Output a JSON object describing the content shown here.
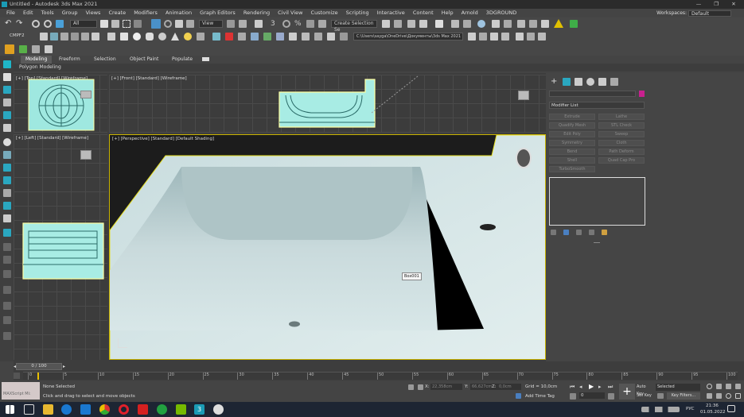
{
  "window": {
    "title": "Untitled - Autodesk 3ds Max 2021",
    "buttons": {
      "minimize": "—",
      "restore": "❐",
      "close": "✕"
    }
  },
  "menu": {
    "items": [
      "File",
      "Edit",
      "Tools",
      "Group",
      "Views",
      "Create",
      "Modifiers",
      "Animation",
      "Graph Editors",
      "Rendering",
      "Civil View",
      "Customize",
      "Scripting",
      "Interactive",
      "Content",
      "Help",
      "Arnold",
      "3DGROUND"
    ],
    "workspaces_label": "Workspaces:",
    "workspaces_value": "Default"
  },
  "toolbar": {
    "selection_filter": "All",
    "ref_coord": "View",
    "named_selection": "Create Selection Se",
    "project_path": "C:\\Users\\sayga\\OneDrive\\Документы\\3ds Max 2021",
    "cmp_label": "CMPF2"
  },
  "ribbon": {
    "tabs": [
      "Modeling",
      "Freeform",
      "Selection",
      "Object Paint",
      "Populate"
    ],
    "active_tab": "Modeling",
    "sub_label": "Polygon Modeling"
  },
  "viewports": {
    "top": "[+] [Top] [Standard] [Wireframe]",
    "front": "[+] [Front] [Standard] [Wireframe]",
    "left": "[+] [Left] [Standard] [Wireframe]",
    "perspective": "[+] [Perspective] [Standard] [Default Shading]",
    "object_tooltip": "Box001"
  },
  "command_panel": {
    "modifier_list": "Modifier List",
    "swatch_color": "#c8208f",
    "buttons": [
      "Extrude",
      "Lathe",
      "Quadify Mesh",
      "STL Check",
      "Edit Poly",
      "Sweep",
      "Symmetry",
      "Cloth",
      "Bend",
      "Path Deform",
      "Shell",
      "Quad Cap Pro",
      "TurboSmooth"
    ]
  },
  "timeline": {
    "frame_counter": "0 / 100",
    "ticks": [
      "0",
      "5",
      "10",
      "15",
      "20",
      "25",
      "30",
      "35",
      "40",
      "45",
      "50",
      "55",
      "60",
      "65",
      "70",
      "75",
      "80",
      "85",
      "90",
      "95",
      "100"
    ],
    "slider_fraction": 0.0
  },
  "status": {
    "maxscript": "MAXScript Mi:",
    "selection": "None Selected",
    "prompt": "Click and drag to select and move objects",
    "x_label": "X:",
    "x_value": "22,358cm",
    "y_label": "Y:",
    "y_value": "66,627cm",
    "z_label": "Z:",
    "z_value": "0,0cm",
    "grid": "Grid = 10,0cm",
    "add_time_tag": "Add Time Tag",
    "frame": "0",
    "auto_key": "Auto Key",
    "set_key": "Set Key",
    "selected": "Selected",
    "key_filters": "Key Filters..."
  },
  "taskbar": {
    "lang": "РУС",
    "time": "21:36",
    "date": "01.05.2022"
  }
}
